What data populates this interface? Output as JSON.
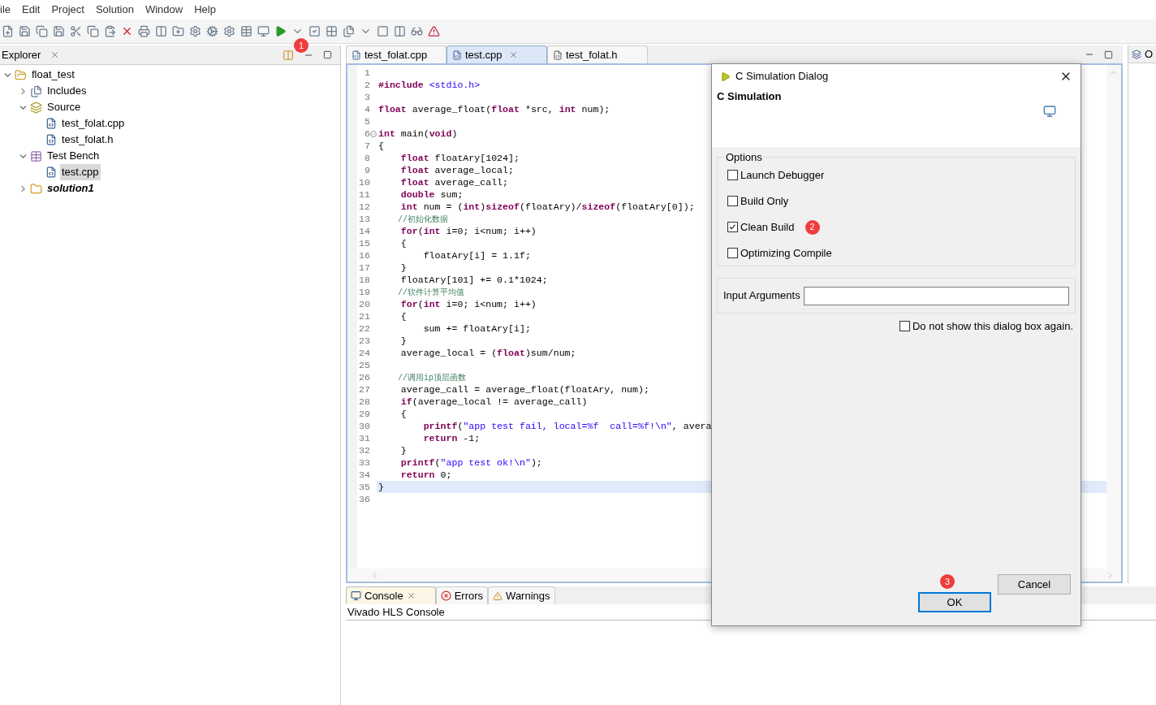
{
  "menu": [
    "ile",
    "Edit",
    "Project",
    "Solution",
    "Window",
    "Help"
  ],
  "explorer": {
    "title": "Explorer",
    "tree": [
      {
        "label": "float_test",
        "kind": "project",
        "expanded": true,
        "selected": false,
        "children": [
          {
            "label": "Includes",
            "kind": "includes",
            "expanded": false,
            "selected": false
          },
          {
            "label": "Source",
            "kind": "source",
            "expanded": true,
            "selected": false,
            "children": [
              {
                "label": "test_folat.cpp",
                "kind": "file",
                "selected": false
              },
              {
                "label": "test_folat.h",
                "kind": "file",
                "selected": false
              }
            ]
          },
          {
            "label": "Test Bench",
            "kind": "testbench",
            "expanded": true,
            "selected": false,
            "children": [
              {
                "label": "test.cpp",
                "kind": "file",
                "selected": true
              }
            ]
          },
          {
            "label": "solution1",
            "kind": "solution",
            "expanded": false,
            "selected": false
          }
        ]
      }
    ]
  },
  "editor_tabs": [
    {
      "label": "test_folat.cpp",
      "kind": "cpp",
      "selected": false
    },
    {
      "label": "test.cpp",
      "kind": "cpp",
      "selected": true
    },
    {
      "label": "test_folat.h",
      "kind": "h",
      "selected": false
    }
  ],
  "code": [
    {
      "n": "1",
      "current": false,
      "fold": false
    },
    {
      "n": "2",
      "current": false,
      "fold": false,
      "tokens": [
        {
          "kind": "kw",
          "text": "#include"
        },
        {
          "kind": "str",
          "text": " <stdio.h>"
        }
      ]
    },
    {
      "n": "3",
      "current": false,
      "fold": false
    },
    {
      "n": "4",
      "current": false,
      "fold": false,
      "tokens": [
        {
          "kind": "kw",
          "text": "float"
        },
        {
          "kind": "plain",
          "text": " average_float("
        },
        {
          "kind": "kw",
          "text": "float"
        },
        {
          "kind": "plain",
          "text": " *src, "
        },
        {
          "kind": "kw",
          "text": "int"
        },
        {
          "kind": "plain",
          "text": " num);"
        }
      ]
    },
    {
      "n": "5",
      "current": false,
      "fold": false
    },
    {
      "n": "6",
      "current": false,
      "fold": true,
      "tokens": [
        {
          "kind": "kw",
          "text": "int"
        },
        {
          "kind": "plain",
          "text": " main("
        },
        {
          "kind": "kw",
          "text": "void"
        },
        {
          "kind": "plain",
          "text": ")"
        }
      ]
    },
    {
      "n": "7",
      "current": false,
      "fold": false,
      "tokens": [
        {
          "kind": "plain",
          "text": "{"
        }
      ]
    },
    {
      "n": "8",
      "current": false,
      "fold": false,
      "tokens": [
        {
          "kind": "kw",
          "text": "    float"
        },
        {
          "kind": "plain",
          "text": " floatAry[1024];"
        }
      ]
    },
    {
      "n": "9",
      "current": false,
      "fold": false,
      "tokens": [
        {
          "kind": "kw",
          "text": "    float"
        },
        {
          "kind": "plain",
          "text": " average_local;"
        }
      ]
    },
    {
      "n": "10",
      "current": false,
      "fold": false,
      "tokens": [
        {
          "kind": "kw",
          "text": "    float"
        },
        {
          "kind": "plain",
          "text": " average_call;"
        }
      ]
    },
    {
      "n": "11",
      "current": false,
      "fold": false,
      "tokens": [
        {
          "kind": "kw",
          "text": "    double"
        },
        {
          "kind": "plain",
          "text": " sum;"
        }
      ]
    },
    {
      "n": "12",
      "current": false,
      "fold": false,
      "tokens": [
        {
          "kind": "kw",
          "text": "    int"
        },
        {
          "kind": "plain",
          "text": " num = ("
        },
        {
          "kind": "kw",
          "text": "int"
        },
        {
          "kind": "plain",
          "text": ")"
        },
        {
          "kind": "kw",
          "text": "sizeof"
        },
        {
          "kind": "plain",
          "text": "(floatAry)/"
        },
        {
          "kind": "kw",
          "text": "sizeof"
        },
        {
          "kind": "plain",
          "text": "(floatAry[0]);"
        }
      ]
    },
    {
      "n": "13",
      "current": false,
      "fold": false,
      "tokens": [
        {
          "kind": "comment",
          "text": "    //初始化数据"
        }
      ]
    },
    {
      "n": "14",
      "current": false,
      "fold": false,
      "tokens": [
        {
          "kind": "kw",
          "text": "    for"
        },
        {
          "kind": "plain",
          "text": "("
        },
        {
          "kind": "kw",
          "text": "int"
        },
        {
          "kind": "plain",
          "text": " i=0; i<num; i++)"
        }
      ]
    },
    {
      "n": "15",
      "current": false,
      "fold": false,
      "tokens": [
        {
          "kind": "plain",
          "text": "    {"
        }
      ]
    },
    {
      "n": "16",
      "current": false,
      "fold": false,
      "tokens": [
        {
          "kind": "plain",
          "text": "        floatAry[i] = 1.1f;"
        }
      ]
    },
    {
      "n": "17",
      "current": false,
      "fold": false,
      "tokens": [
        {
          "kind": "plain",
          "text": "    }"
        }
      ]
    },
    {
      "n": "18",
      "current": false,
      "fold": false,
      "tokens": [
        {
          "kind": "plain",
          "text": "    floatAry[101] += 0.1*1024;"
        }
      ]
    },
    {
      "n": "19",
      "current": false,
      "fold": false,
      "tokens": [
        {
          "kind": "comment",
          "text": "    //软件计算平均值"
        }
      ]
    },
    {
      "n": "20",
      "current": false,
      "fold": false,
      "tokens": [
        {
          "kind": "kw",
          "text": "    for"
        },
        {
          "kind": "plain",
          "text": "("
        },
        {
          "kind": "kw",
          "text": "int"
        },
        {
          "kind": "plain",
          "text": " i=0; i<num; i++)"
        }
      ]
    },
    {
      "n": "21",
      "current": false,
      "fold": false,
      "tokens": [
        {
          "kind": "plain",
          "text": "    {"
        }
      ]
    },
    {
      "n": "22",
      "current": false,
      "fold": false,
      "tokens": [
        {
          "kind": "plain",
          "text": "        sum += floatAry[i];"
        }
      ]
    },
    {
      "n": "23",
      "current": false,
      "fold": false,
      "tokens": [
        {
          "kind": "plain",
          "text": "    }"
        }
      ]
    },
    {
      "n": "24",
      "current": false,
      "fold": false,
      "tokens": [
        {
          "kind": "plain",
          "text": "    average_local = ("
        },
        {
          "kind": "kw",
          "text": "float"
        },
        {
          "kind": "plain",
          "text": ")sum/num;"
        }
      ]
    },
    {
      "n": "25",
      "current": false,
      "fold": false
    },
    {
      "n": "26",
      "current": false,
      "fold": false,
      "tokens": [
        {
          "kind": "comment",
          "text": "    //调用ip顶层函数"
        }
      ]
    },
    {
      "n": "27",
      "current": false,
      "fold": false,
      "tokens": [
        {
          "kind": "plain",
          "text": "    average_call = average_float(floatAry, num);"
        }
      ]
    },
    {
      "n": "28",
      "current": false,
      "fold": false,
      "tokens": [
        {
          "kind": "kw",
          "text": "    if"
        },
        {
          "kind": "plain",
          "text": "(average_local != average_call)"
        }
      ]
    },
    {
      "n": "29",
      "current": false,
      "fold": false,
      "tokens": [
        {
          "kind": "plain",
          "text": "    {"
        }
      ]
    },
    {
      "n": "30",
      "current": false,
      "fold": false,
      "tokens": [
        {
          "kind": "kw",
          "text": "        printf"
        },
        {
          "kind": "plain",
          "text": "("
        },
        {
          "kind": "str",
          "text": "\"app test fail, local=%f  call=%f!\\n\""
        },
        {
          "kind": "plain",
          "text": ", avera"
        }
      ]
    },
    {
      "n": "31",
      "current": false,
      "fold": false,
      "tokens": [
        {
          "kind": "kw",
          "text": "        return"
        },
        {
          "kind": "plain",
          "text": " -1;"
        }
      ]
    },
    {
      "n": "32",
      "current": false,
      "fold": false,
      "tokens": [
        {
          "kind": "plain",
          "text": "    }"
        }
      ]
    },
    {
      "n": "33",
      "current": false,
      "fold": false,
      "tokens": [
        {
          "kind": "kw",
          "text": "    printf"
        },
        {
          "kind": "plain",
          "text": "("
        },
        {
          "kind": "str",
          "text": "\"app test ok!\\n\""
        },
        {
          "kind": "plain",
          "text": ");"
        }
      ]
    },
    {
      "n": "34",
      "current": false,
      "fold": false,
      "tokens": [
        {
          "kind": "kw",
          "text": "    return"
        },
        {
          "kind": "plain",
          "text": " 0;"
        }
      ]
    },
    {
      "n": "35",
      "current": true,
      "fold": false,
      "tokens": [
        {
          "kind": "plain",
          "text": "}"
        }
      ]
    },
    {
      "n": "36",
      "current": false,
      "fold": false
    }
  ],
  "right_panel": {
    "title": "O"
  },
  "console": {
    "tabs": [
      {
        "label": "Console",
        "kind": "console",
        "selected": true
      },
      {
        "label": "Errors",
        "kind": "errors",
        "selected": false
      },
      {
        "label": "Warnings",
        "kind": "warnings",
        "selected": false
      }
    ],
    "title": "Vivado HLS Console"
  },
  "dialog": {
    "title": "C Simulation Dialog",
    "heading": "C Simulation",
    "group": "Options",
    "options": [
      {
        "label": "Launch Debugger",
        "checked": false
      },
      {
        "label": "Build Only",
        "checked": false
      },
      {
        "label": "Clean Build",
        "checked": true,
        "badge": "2"
      },
      {
        "label": "Optimizing Compile",
        "checked": false
      }
    ],
    "args_label": "Input Arguments",
    "dont_show": {
      "label": "Do not show this dialog box again.",
      "checked": false
    },
    "buttons": [
      {
        "label": "OK",
        "kind": "default",
        "badge": "3"
      },
      {
        "label": "Cancel",
        "kind": "normal"
      }
    ]
  },
  "toolbar_badge": "1"
}
